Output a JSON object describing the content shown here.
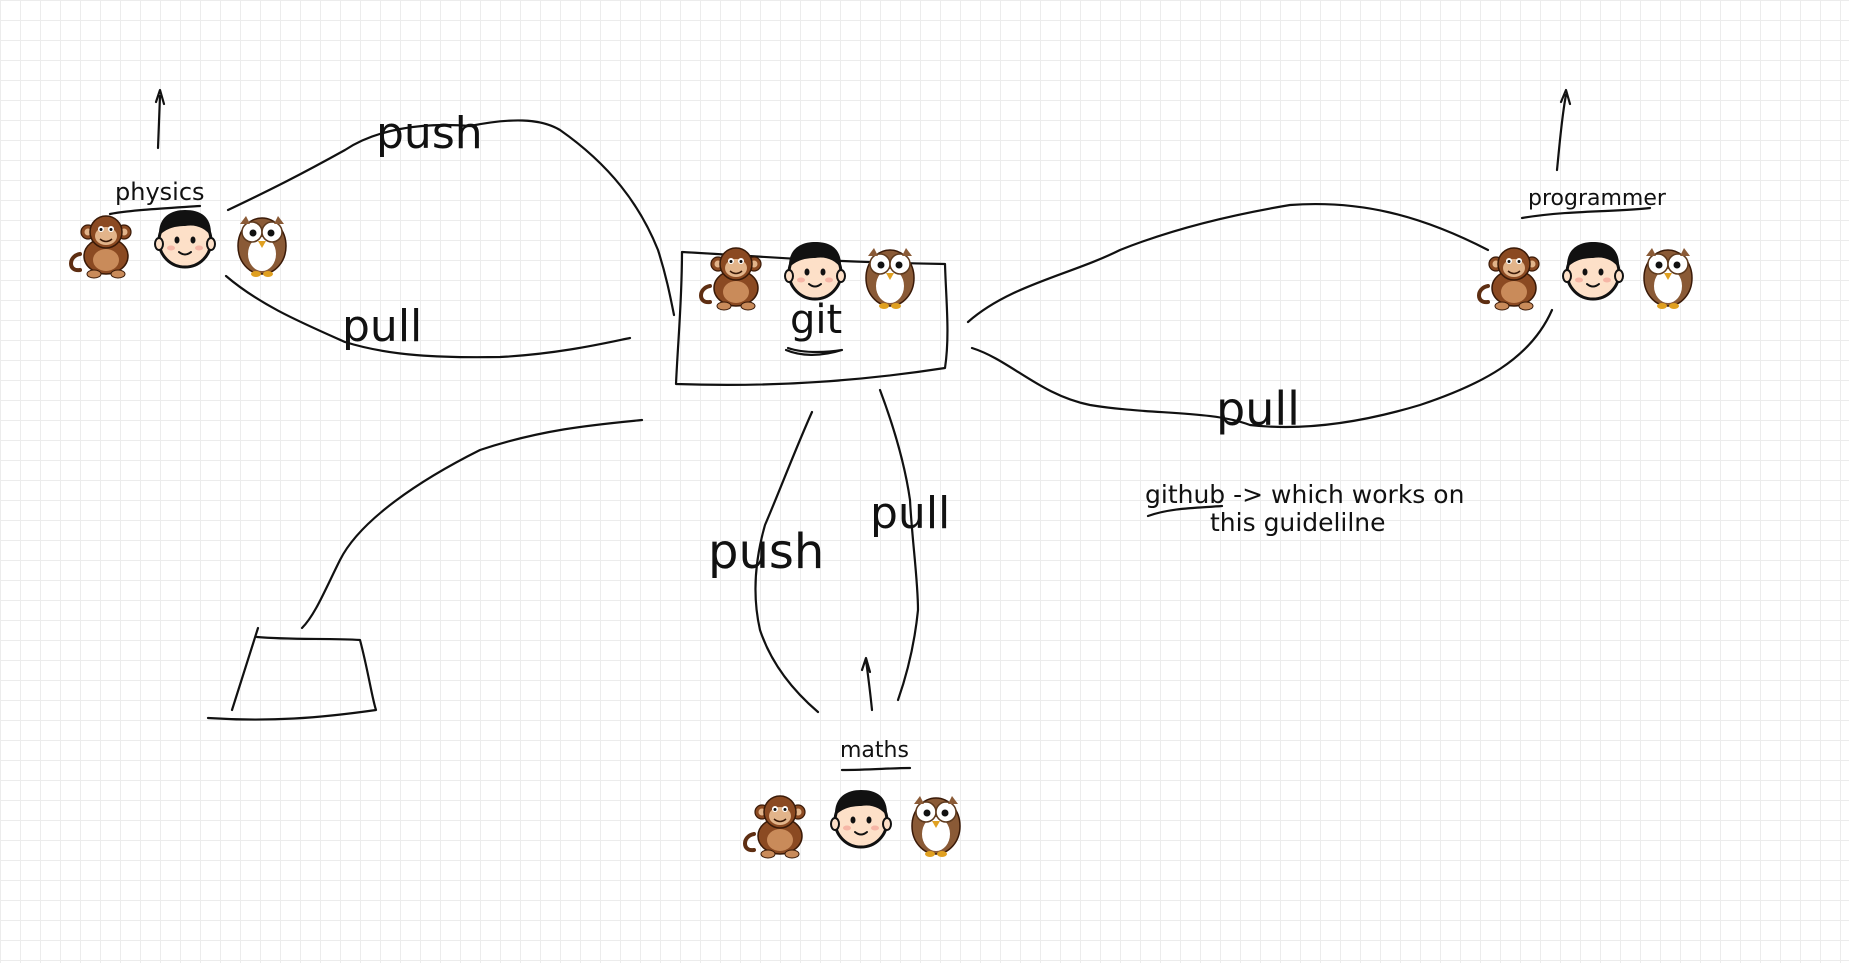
{
  "labels": {
    "physics": "physics",
    "programmer": "programmer",
    "maths": "maths",
    "git": "git",
    "push_left": "push",
    "pull_left": "pull",
    "pull_right": "pull",
    "push_bottom": "push",
    "pull_bottom": "pull",
    "note_line1": "github -> which works on",
    "note_line2": "this guidelilne"
  },
  "avatars": [
    "monkey-icon",
    "boy-icon",
    "owl-icon"
  ],
  "colors": {
    "ink": "#111111",
    "grid": "#ececec",
    "monkey_fur": "#8b4a22",
    "monkey_face": "#e2b48a",
    "skin": "#fde0c8",
    "hair": "#111111",
    "owl_body": "#8a5a36",
    "owl_belly": "#ffffff",
    "owl_beak": "#e0a020"
  }
}
